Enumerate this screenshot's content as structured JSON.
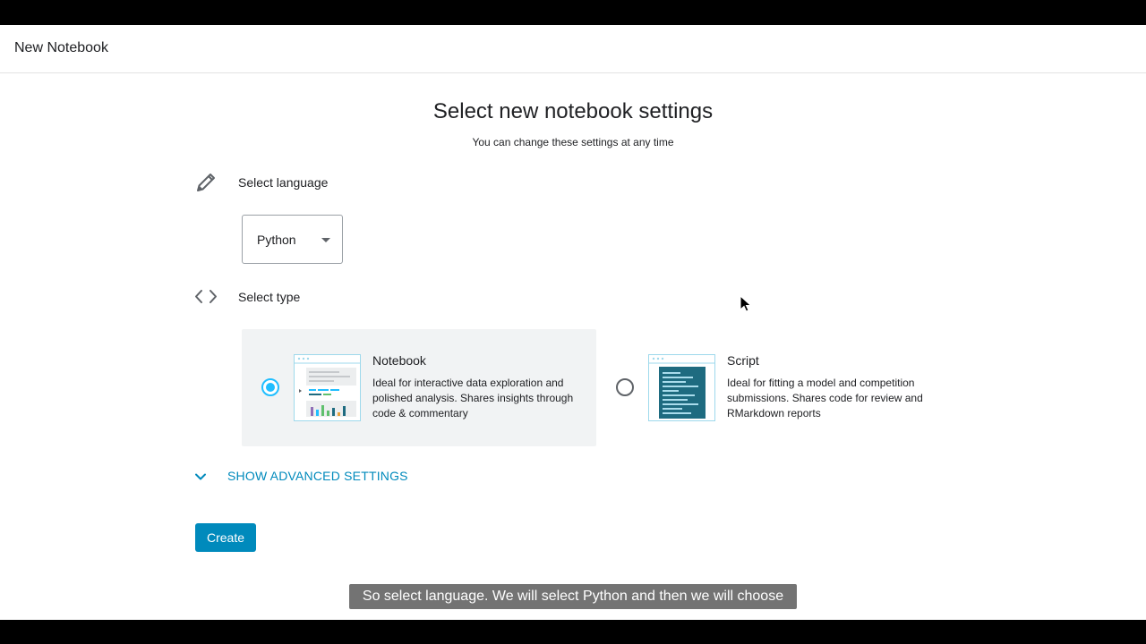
{
  "window": {
    "title": "New Notebook"
  },
  "page": {
    "heading": "Select new notebook settings",
    "subheading": "You can change these settings at any time"
  },
  "language": {
    "label": "Select language",
    "icon": "pencil-icon",
    "selected": "Python"
  },
  "type": {
    "label": "Select type",
    "icon": "code-brackets-icon",
    "options": [
      {
        "title": "Notebook",
        "description": "Ideal for interactive data exploration and polished analysis. Shares insights through code & commentary",
        "selected": true
      },
      {
        "title": "Script",
        "description": "Ideal for fitting a model and competition submissions. Shares code for review and RMarkdown reports",
        "selected": false
      }
    ]
  },
  "advanced": {
    "label": "SHOW ADVANCED SETTINGS",
    "icon": "chevron-down-icon"
  },
  "actions": {
    "create_label": "Create"
  },
  "caption": {
    "text": "So select language. We will select Python and then we will choose"
  },
  "colors": {
    "accent": "#008abc",
    "radio_selected": "#20beff",
    "card_selected_bg": "#f1f3f4"
  }
}
